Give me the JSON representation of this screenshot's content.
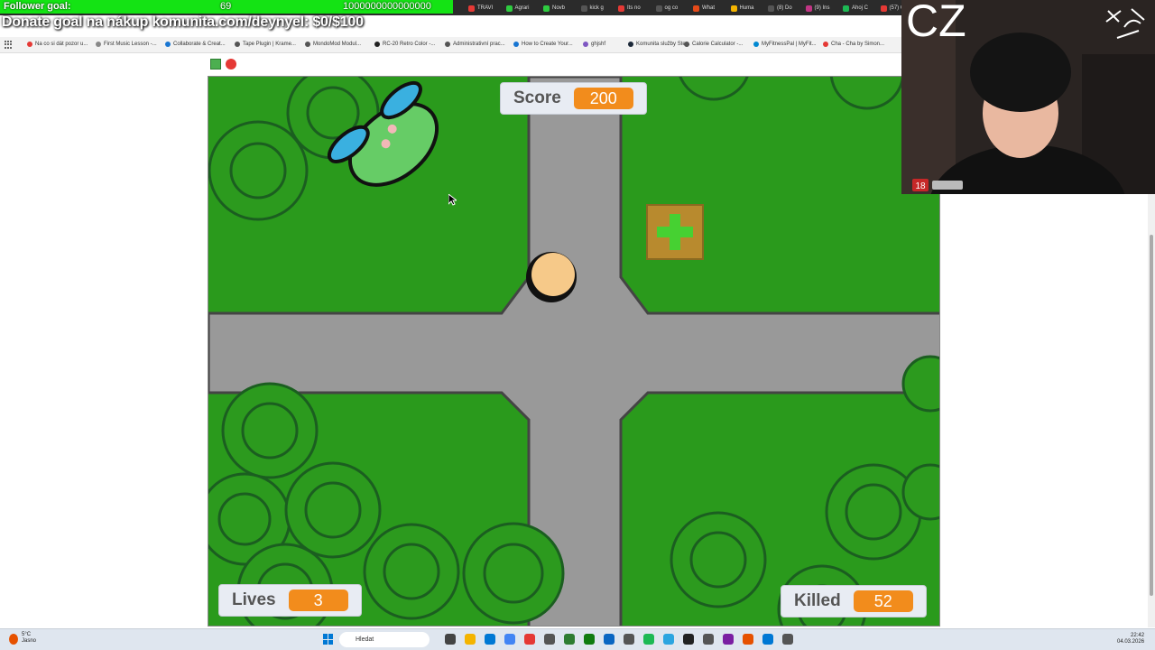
{
  "overlay": {
    "follower_label": "Follower goal:",
    "follower_count": "69",
    "follower_goal": "1000000000000000",
    "donate_text": "Donate goal na nákup komunita.com/deynyel: $0/$100",
    "webcam_tag": "CZ"
  },
  "browser": {
    "tabs": [
      {
        "label": "TRAVI",
        "color": "#e53935"
      },
      {
        "label": "Agrari",
        "color": "#2ecc40"
      },
      {
        "label": "Novb",
        "color": "#2ecc40"
      },
      {
        "label": "kick g",
        "color": "#555"
      },
      {
        "label": "Its no",
        "color": "#e53935"
      },
      {
        "label": "og co",
        "color": "#555"
      },
      {
        "label": "What",
        "color": "#e64a19"
      },
      {
        "label": "Huma",
        "color": "#f4b400"
      },
      {
        "label": "(8) Do",
        "color": "#555"
      },
      {
        "label": "(9) Ins",
        "color": "#c13584"
      },
      {
        "label": "Ahoj C",
        "color": "#1db954"
      },
      {
        "label": "(57) C",
        "color": "#e53935"
      }
    ],
    "bookmarks": [
      {
        "label": "Na co si dát pozor u...",
        "color": "#e53935"
      },
      {
        "label": "First Music Lesson -...",
        "color": "#888"
      },
      {
        "label": "Collaborate & Creat...",
        "color": "#1976d2"
      },
      {
        "label": "Tape Plugin | Krame...",
        "color": "#555"
      },
      {
        "label": "MondoMod Modul...",
        "color": "#555"
      },
      {
        "label": "RC-20 Retro Color -...",
        "color": "#222"
      },
      {
        "label": "Administrativní prac...",
        "color": "#555"
      },
      {
        "label": "How to Create Your...",
        "color": "#1976d2"
      },
      {
        "label": "ghjshf",
        "color": "#7e57c2"
      },
      {
        "label": "Komunita služby Ste...",
        "color": "#1b2838"
      },
      {
        "label": "Calorie Calculator -...",
        "color": "#555"
      },
      {
        "label": "MyFitnessPal | MyFit...",
        "color": "#0288d1"
      },
      {
        "label": "Cha - Cha by Simon...",
        "color": "#e53935"
      }
    ]
  },
  "game": {
    "score_label": "Score",
    "score_value": "200",
    "lives_label": "Lives",
    "lives_value": "3",
    "killed_label": "Killed",
    "killed_value": "52",
    "colors": {
      "grass": "#2a9a1c",
      "road": "#999999",
      "road_edge": "#444444",
      "bush": "#2c9a1e",
      "bush_line": "#1b5e20",
      "monitor_value": "#f28c1c"
    }
  },
  "taskbar": {
    "weather_temp": "5°C",
    "weather_desc": "Jasno",
    "search_placeholder": "Hledat",
    "time": "22:42",
    "date": "04.03.2026"
  }
}
